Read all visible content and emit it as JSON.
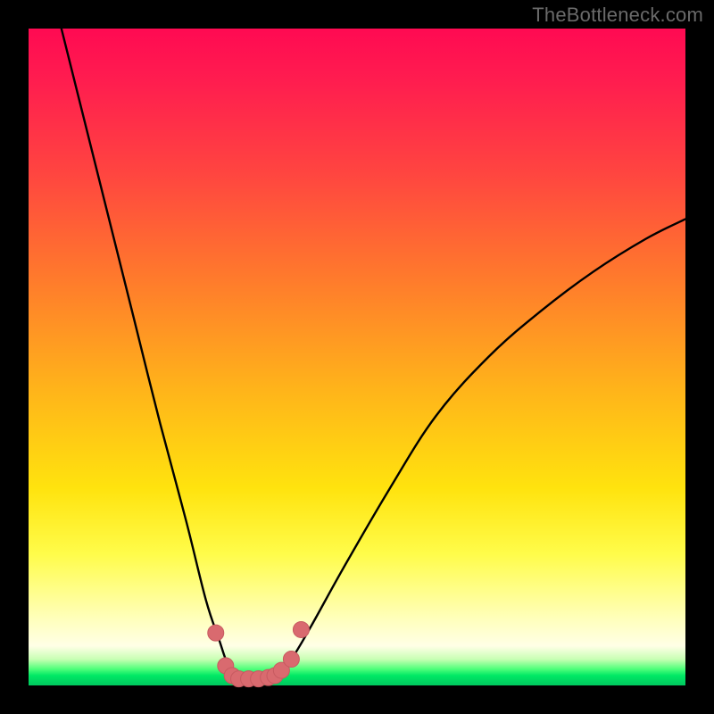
{
  "watermark": "TheBottleneck.com",
  "colors": {
    "curve_stroke": "#000000",
    "marker_fill": "#d96a6f",
    "marker_stroke": "#c75a60",
    "gradient_top": "#ff0a52",
    "gradient_mid": "#ffe30e",
    "gradient_bottom": "#00c85e",
    "frame": "#000000"
  },
  "chart_data": {
    "type": "line",
    "title": "",
    "xlabel": "",
    "ylabel": "",
    "xlim": [
      0,
      100
    ],
    "ylim": [
      0,
      100
    ],
    "grid": false,
    "legend": false,
    "series": [
      {
        "name": "bottleneck-curve",
        "x": [
          5,
          8,
          12,
          16,
          20,
          24,
          27,
          29,
          30,
          31,
          32,
          33,
          35,
          37,
          38,
          40,
          43,
          48,
          55,
          62,
          70,
          78,
          86,
          94,
          100
        ],
        "y": [
          100,
          88,
          72,
          56,
          40,
          25,
          13,
          7,
          4,
          2,
          1,
          1,
          1,
          1,
          2,
          4,
          9,
          18,
          30,
          41,
          50,
          57,
          63,
          68,
          71
        ]
      }
    ],
    "markers": {
      "name": "highlight-points",
      "x": [
        28.5,
        30,
        31,
        32,
        33.5,
        35,
        36.5,
        37.5,
        38.5,
        40,
        41.5
      ],
      "y": [
        8,
        3,
        1.5,
        1,
        1,
        1,
        1.2,
        1.5,
        2.3,
        4,
        8.5
      ]
    }
  }
}
